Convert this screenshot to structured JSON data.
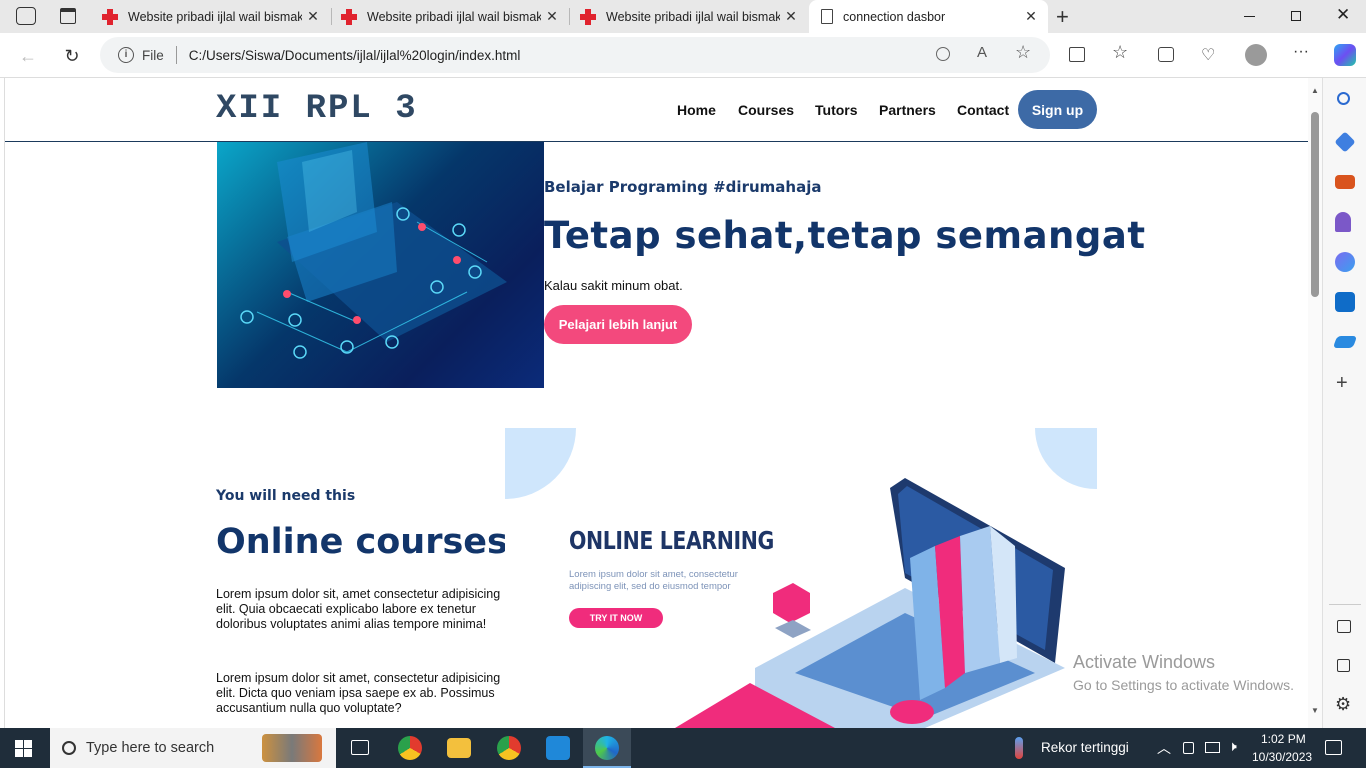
{
  "browser": {
    "tabs": [
      {
        "title": "Website pribadi ijlal wail bismaka",
        "icon": "red-cross-icon"
      },
      {
        "title": "Website pribadi ijlal wail bismaka",
        "icon": "red-cross-icon"
      },
      {
        "title": "Website pribadi ijlal wail bismaka",
        "icon": "red-cross-icon"
      },
      {
        "title": "connection dasbor",
        "icon": "document-icon"
      }
    ],
    "close_glyph": "✕",
    "new_tab_glyph": "+",
    "address": {
      "scheme_label": "File",
      "url": "C:/Users/Siswa/Documents/ijlal/ijlal%20login/index.html"
    }
  },
  "site": {
    "logo": "XII RPL 3",
    "nav": [
      "Home",
      "Courses",
      "Tutors",
      "Partners",
      "Contact"
    ],
    "signup_label": "Sign up",
    "hero": {
      "subtitle": "Belajar Programing #dirumahaja",
      "title": "Tetap sehat,tetap semangat",
      "text": "Kalau sakit minum obat.",
      "button": "Pelajari lebih lanjut"
    },
    "courses": {
      "subtitle": "You will need this",
      "title": "Online courses",
      "paragraphs": [
        "Lorem ipsum dolor sit, amet consectetur adipisicing elit. Quia obcaecati explicabo labore ex tenetur doloribus voluptates animi alias tempore minima!",
        "Lorem ipsum dolor sit amet, consectetur adipisicing elit. Dicta quo veniam ipsa saepe ex ab. Possimus accusantium nulla quo voluptate?"
      ],
      "illustration": {
        "heading": "ONLINE LEARNING",
        "text": "Lorem ipsum dolor sit amet, consectetur adipiscing elit, sed do eiusmod tempor",
        "button": "TRY IT NOW"
      }
    }
  },
  "watermark": {
    "line1": "Activate Windows",
    "line2": "Go to Settings to activate Windows."
  },
  "taskbar": {
    "search_placeholder": "Type here to search",
    "weather": "Rekor tertinggi",
    "time": "1:02 PM",
    "date": "10/30/2023"
  },
  "colors": {
    "brand_dark": "#12356a",
    "signup": "#3d6aa6",
    "cta_pink": "#f3497d"
  }
}
